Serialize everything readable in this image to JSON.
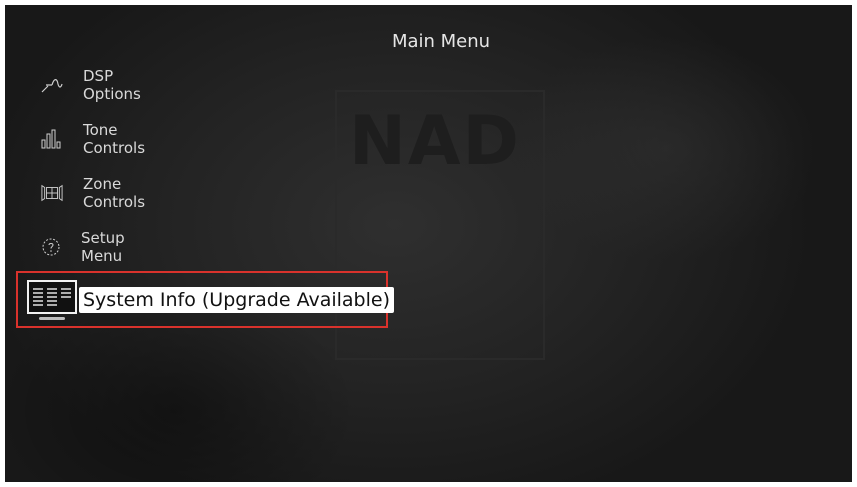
{
  "header": {
    "title": "Main Menu"
  },
  "watermark": {
    "logo_text": "NAD"
  },
  "menu": {
    "items": [
      {
        "label": "DSP Options",
        "icon": "dsp-wave-icon"
      },
      {
        "label": "Tone Controls",
        "icon": "equalizer-bars-icon"
      },
      {
        "label": "Zone Controls",
        "icon": "zone-speakers-icon"
      },
      {
        "label": "Setup Menu",
        "icon": "gear-icon"
      },
      {
        "label": "System Info (Upgrade Available)",
        "icon": "system-info-monitor-icon",
        "selected": true
      }
    ]
  },
  "colors": {
    "highlight_border": "#d9322c",
    "text": "#d9d9d9",
    "background": "#232323"
  }
}
